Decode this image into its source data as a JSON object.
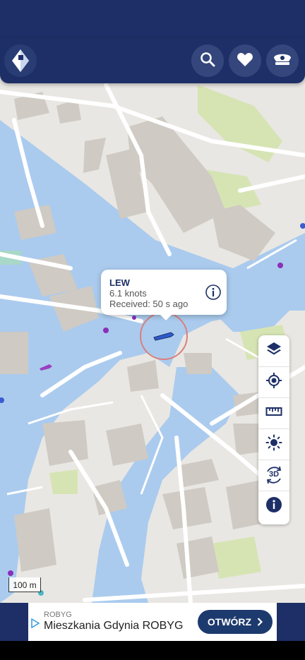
{
  "header": {
    "logo_icon": "ship-logo-icon",
    "actions": [
      {
        "icon": "search-icon"
      },
      {
        "icon": "heart-icon"
      },
      {
        "icon": "captain-hat-icon"
      }
    ]
  },
  "vessel_popup": {
    "name": "LEW",
    "speed": "6.1 knots",
    "received": "Received: 50 s ago",
    "info_icon": "info-circle-icon"
  },
  "map_tools": [
    {
      "icon": "layers-icon"
    },
    {
      "icon": "locate-icon"
    },
    {
      "icon": "ruler-icon"
    },
    {
      "icon": "brightness-icon"
    },
    {
      "icon": "3d-rotate-icon",
      "label": "3D"
    },
    {
      "icon": "info-icon"
    }
  ],
  "scale": {
    "label": "100 m"
  },
  "ad": {
    "brand": "ROBYG",
    "title": "Mieszkania Gdynia ROBYG",
    "button": "OTWÓRZ"
  },
  "colors": {
    "primary": "#1d2f66",
    "water": "#aacbee",
    "land": "#e9e7e3",
    "park": "#d6e4b4",
    "building": "#cfcac3"
  }
}
